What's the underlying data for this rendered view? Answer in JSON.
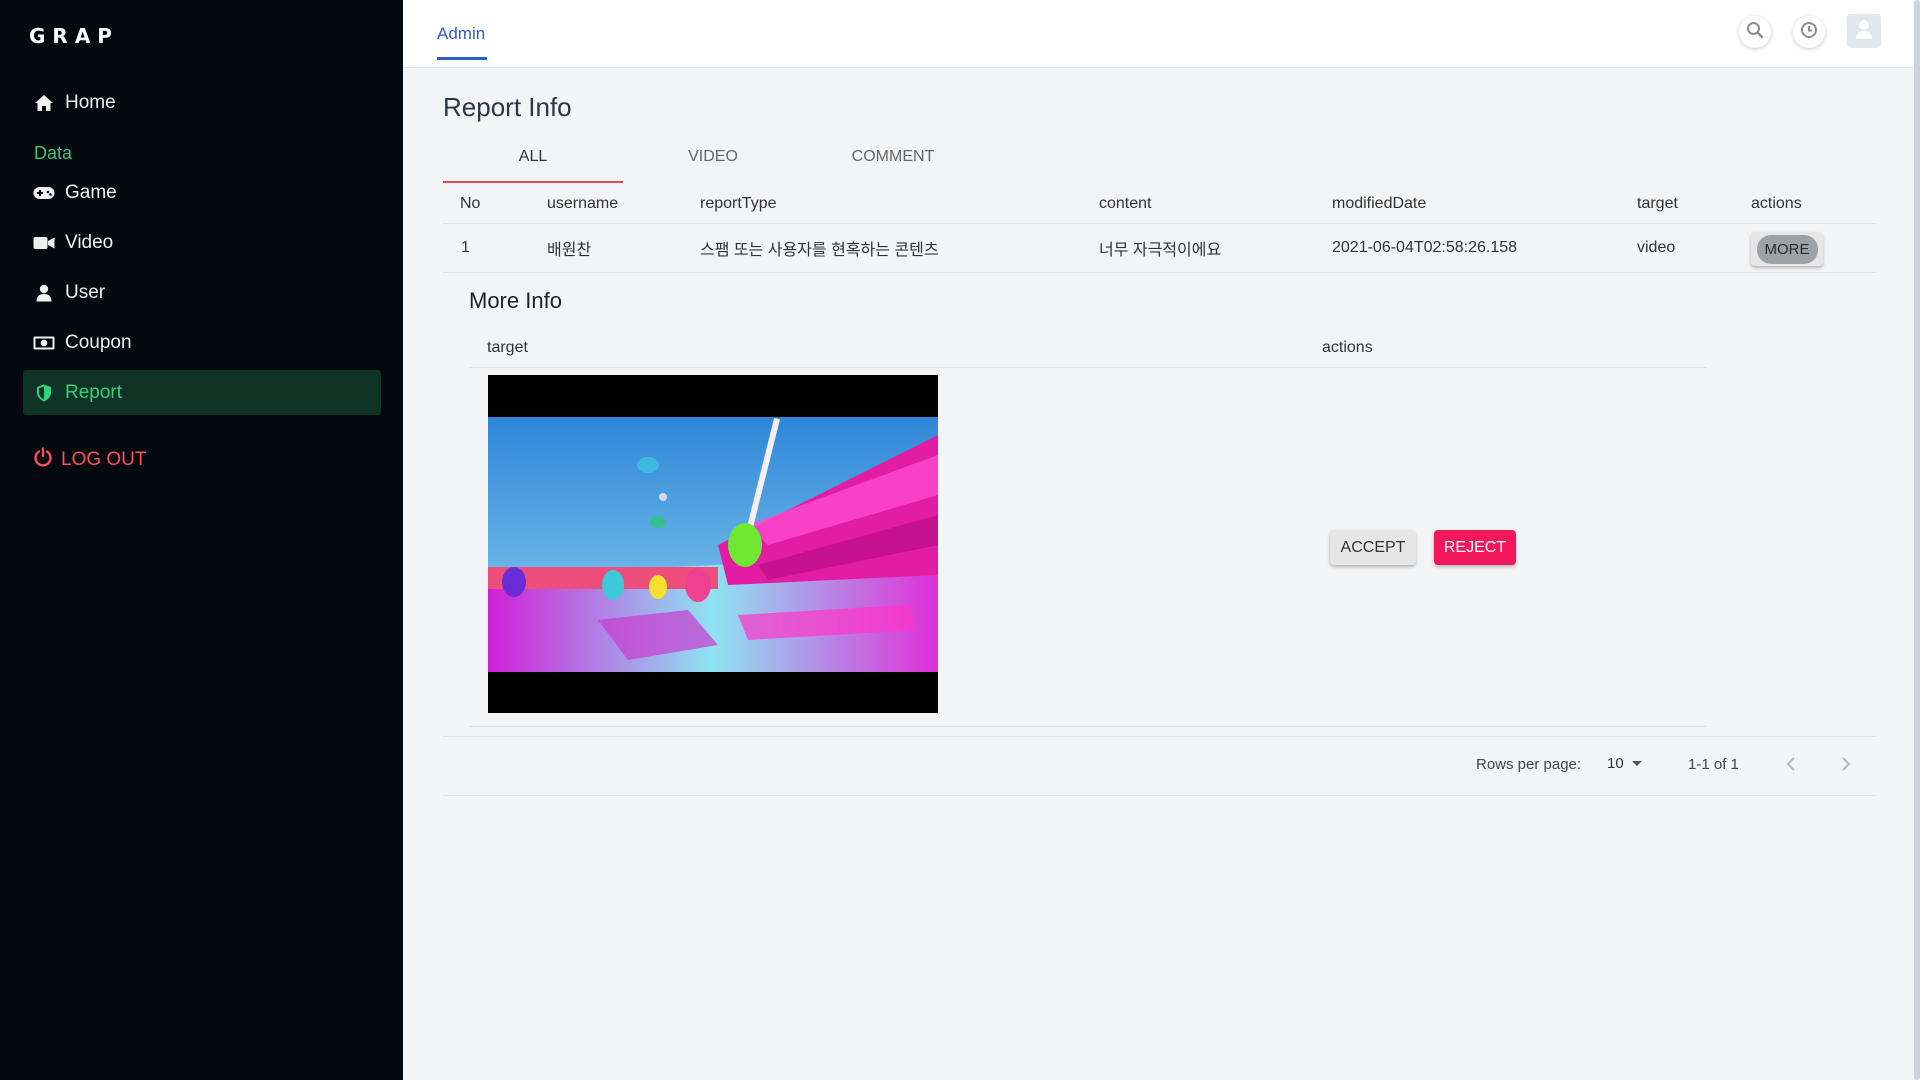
{
  "sidebar": {
    "logo": "GRAP",
    "section_label": "Data",
    "items": [
      {
        "label": "Home",
        "icon": "home-icon"
      },
      {
        "label": "Game",
        "icon": "gamepad-icon"
      },
      {
        "label": "Video",
        "icon": "video-camera-icon"
      },
      {
        "label": "User",
        "icon": "user-icon"
      },
      {
        "label": "Coupon",
        "icon": "money-bill-icon"
      },
      {
        "label": "Report",
        "icon": "shield-icon",
        "active": true
      }
    ],
    "logout_label": "LOG OUT",
    "accent": "#34d17a",
    "logout_color": "#ff4d5a"
  },
  "topbar": {
    "tab_label": "Admin",
    "icons": [
      "search-icon",
      "clock-icon",
      "avatar-icon"
    ],
    "accent": "#2d5bd3"
  },
  "page": {
    "title": "Report Info",
    "tabs": [
      "ALL",
      "VIDEO",
      "COMMENT"
    ],
    "active_tab": "ALL"
  },
  "table": {
    "headers": [
      "No",
      "username",
      "reportType",
      "content",
      "modifiedDate",
      "target",
      "actions"
    ],
    "rows": [
      {
        "no": "1",
        "username": "배원찬",
        "reportType": "스팸 또는 사용자를 현혹하는 콘텐츠",
        "content": "너무 자극적이에요",
        "modifiedDate": "2021-06-04T02:58:26.158",
        "target": "video",
        "action_label": "MORE"
      }
    ]
  },
  "more_info": {
    "title": "More Info",
    "headers": [
      "target",
      "actions"
    ],
    "accept_label": "ACCEPT",
    "reject_label": "REJECT",
    "reject_color": "#f0185a"
  },
  "pagination": {
    "rows_per_page_label": "Rows per page:",
    "rows_per_page_value": "10",
    "range": "1-1 of 1"
  }
}
